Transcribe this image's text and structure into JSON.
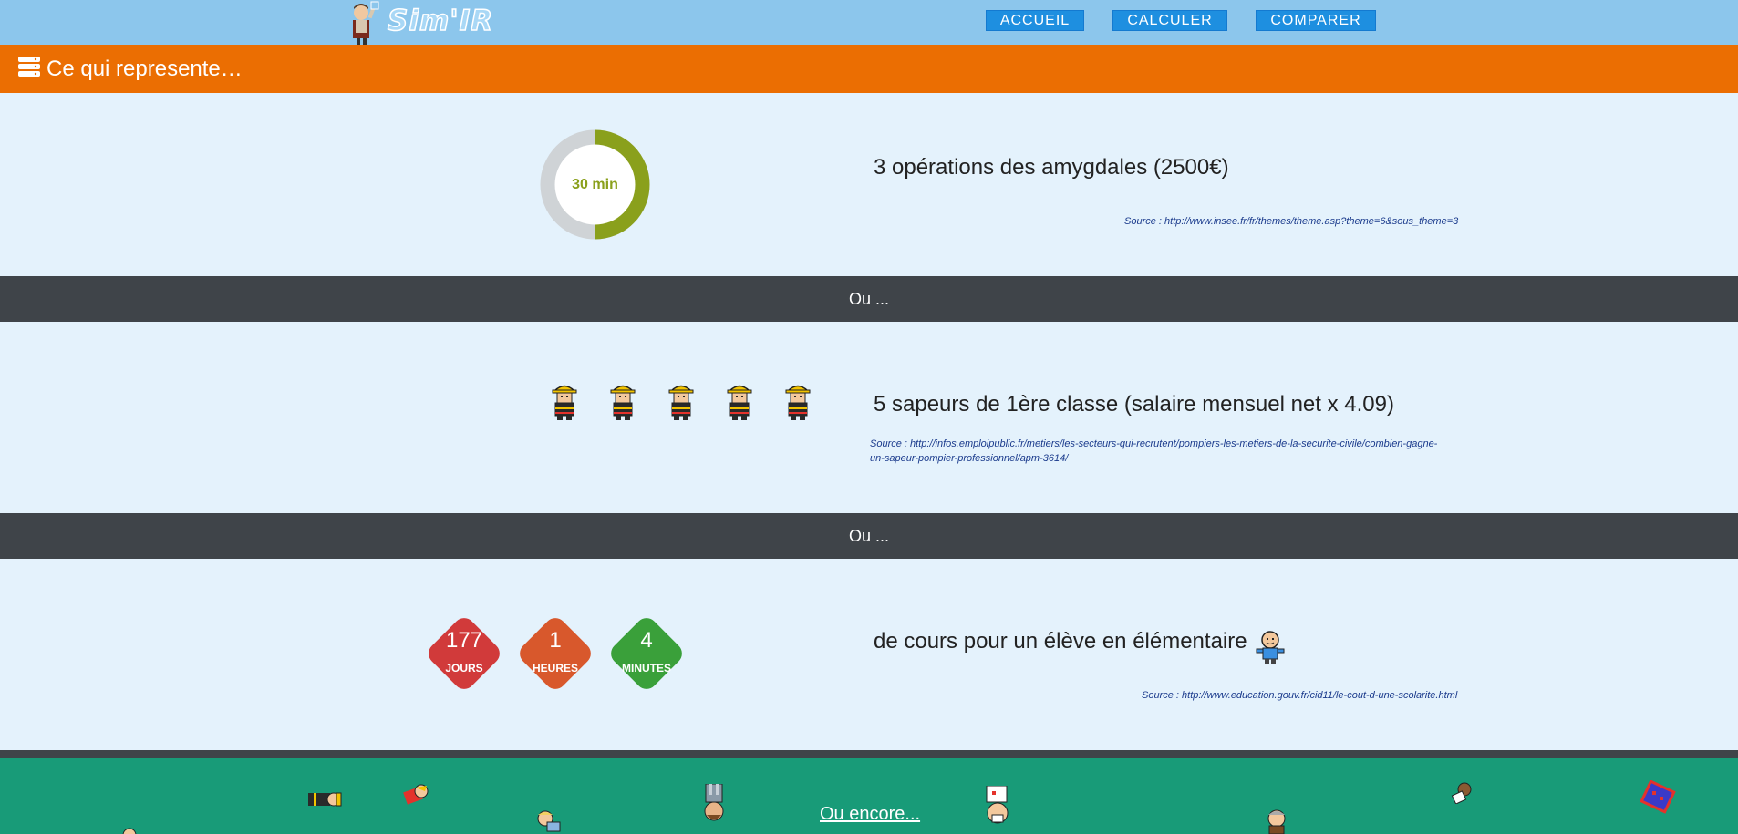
{
  "header": {
    "logo_text": "Sim'IR",
    "nav": [
      "ACCUEIL",
      "CALCULER",
      "COMPARER"
    ]
  },
  "section": {
    "title": "Ce qui represente…"
  },
  "items": [
    {
      "visual": {
        "type": "donut",
        "label": "30 min",
        "progress": 0.5,
        "color": "#8aa01c"
      },
      "text": "3 opérations des amygdales (2500€)",
      "source": "Source : http://www.insee.fr/fr/themes/theme.asp?theme=6&sous_theme=3"
    },
    {
      "visual": {
        "type": "icons",
        "icon": "fireman-icon",
        "count": 5
      },
      "text": "5 sapeurs de 1ère classe (salaire mensuel net x 4.09)",
      "source_line1": "Source : http://infos.emploipublic.fr/metiers/les-secteurs-qui-recrutent/pompiers-les-metiers-de-la-securite-civile/combien-gagne-",
      "source_line2": "un-sapeur-pompier-professionnel/apm-3614/"
    },
    {
      "visual": {
        "type": "countdown",
        "blocks": [
          {
            "value": "177",
            "unit": "JOURS",
            "color": "#d13a3a"
          },
          {
            "value": "1",
            "unit": "HEURES",
            "color": "#d8582c"
          },
          {
            "value": "4",
            "unit": "MINUTES",
            "color": "#3aa03a"
          }
        ]
      },
      "text": "de cours pour un élève en élémentaire",
      "icon": "student-icon",
      "source": "Source : http://www.education.gouv.fr/cid11/le-cout-d-une-scolarite.html"
    }
  ],
  "separator_label": "Ou ...",
  "footer": {
    "link": "Ou encore..."
  }
}
